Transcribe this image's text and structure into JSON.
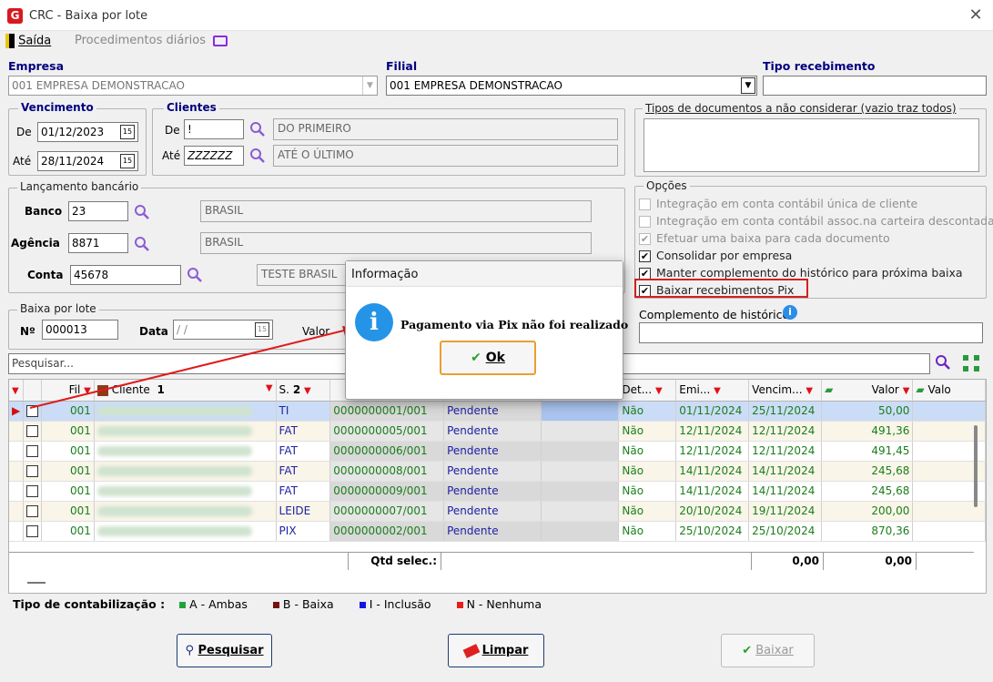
{
  "window": {
    "title": "CRC - Baixa por lote"
  },
  "menu": {
    "exit": "Saída",
    "daily": "Procedimentos diários"
  },
  "empresa": {
    "label": "Empresa",
    "value": "001 EMPRESA DEMONSTRACAO"
  },
  "filial": {
    "label": "Filial",
    "value": "001 EMPRESA DEMONSTRACAO"
  },
  "tipo_recebimento": {
    "label": "Tipo recebimento",
    "value": ""
  },
  "vencimento": {
    "title": "Vencimento",
    "de_label": "De",
    "de": "01/12/2023",
    "ate_label": "Até",
    "ate": "28/11/2024"
  },
  "clientes": {
    "title": "Clientes",
    "de_label": "De",
    "de": "!",
    "de_desc": "DO PRIMEIRO",
    "ate_label": "Até",
    "ate": "ZZZZZZ",
    "ate_desc": "ATÉ O ÚLTIMO"
  },
  "tipos_doc": {
    "title": "Tipos de documentos a não considerar (vazio traz todos)"
  },
  "lancamento": {
    "title": "Lançamento bancário",
    "banco_label": "Banco",
    "banco": "23",
    "banco_desc": "BRASIL",
    "agencia_label": "Agência",
    "agencia": "8871",
    "agencia_desc": "BRASIL",
    "conta_label": "Conta",
    "conta": "45678",
    "conta_desc": "TESTE BRASIL"
  },
  "opcoes": {
    "title": "Opções",
    "items": [
      {
        "label": "Integração em conta contábil única de cliente",
        "checked": false,
        "disabled": true
      },
      {
        "label": "Integração em conta contábil assoc.na carteira descontada",
        "checked": false,
        "disabled": true
      },
      {
        "label": "Efetuar uma baixa para cada documento",
        "checked": true,
        "disabled": true
      },
      {
        "label": "Consolidar por empresa",
        "checked": true,
        "disabled": false
      },
      {
        "label": "Manter complemento do histórico para próxima baixa",
        "checked": true,
        "disabled": false
      },
      {
        "label": "Baixar recebimentos Pix",
        "checked": true,
        "disabled": false
      }
    ]
  },
  "baixa_lote": {
    "title": "Baixa por lote",
    "num_label": "Nº",
    "num": "000013",
    "data_label": "Data",
    "data": " /  /",
    "valor_label": "Valor"
  },
  "complemento": {
    "label": "Complemento de histórico",
    "value": ""
  },
  "search": {
    "placeholder": "Pesquisar..."
  },
  "grid": {
    "headers": {
      "fil": "Fil",
      "cliente": "Cliente",
      "sort1": "1",
      "s": "S.",
      "sort2": "2",
      "det": "Det...",
      "emi": "Emi...",
      "venc": "Vencim...",
      "valor": "Valor",
      "valo": "Valo"
    },
    "rows": [
      {
        "fil": "001",
        "s": "TI",
        "doc": "0000000001/001",
        "status": "Pendente",
        "det": "Não",
        "emi": "01/11/2024",
        "venc": "25/11/2024",
        "valor": "50,00"
      },
      {
        "fil": "001",
        "s": "FAT",
        "doc": "0000000005/001",
        "status": "Pendente",
        "det": "Não",
        "emi": "12/11/2024",
        "venc": "12/11/2024",
        "valor": "491,36"
      },
      {
        "fil": "001",
        "s": "FAT",
        "doc": "0000000006/001",
        "status": "Pendente",
        "det": "Não",
        "emi": "12/11/2024",
        "venc": "12/11/2024",
        "valor": "491,45"
      },
      {
        "fil": "001",
        "s": "FAT",
        "doc": "0000000008/001",
        "status": "Pendente",
        "det": "Não",
        "emi": "14/11/2024",
        "venc": "14/11/2024",
        "valor": "245,68"
      },
      {
        "fil": "001",
        "s": "FAT",
        "doc": "0000000009/001",
        "status": "Pendente",
        "det": "Não",
        "emi": "14/11/2024",
        "venc": "14/11/2024",
        "valor": "245,68"
      },
      {
        "fil": "001",
        "s": "LEIDE",
        "doc": "0000000007/001",
        "status": "Pendente",
        "det": "Não",
        "emi": "20/10/2024",
        "venc": "19/11/2024",
        "valor": "200,00"
      },
      {
        "fil": "001",
        "s": "PIX",
        "doc": "0000000002/001",
        "status": "Pendente",
        "det": "Não",
        "emi": "25/10/2024",
        "venc": "25/10/2024",
        "valor": "870,36"
      }
    ],
    "footer": {
      "qtd_label": "Qtd selec.:",
      "total1": "0,00",
      "total2": "0,00"
    }
  },
  "legend": {
    "label": "Tipo de contabilização :",
    "items": [
      {
        "text": "A - Ambas",
        "color": "#22a33a"
      },
      {
        "text": "B - Baixa",
        "color": "#7a0f0f"
      },
      {
        "text": "I - Inclusão",
        "color": "#1515e0"
      },
      {
        "text": "N - Nenhuma",
        "color": "#e81c1c"
      }
    ]
  },
  "buttons": {
    "pesquisar": "Pesquisar",
    "limpar": "Limpar",
    "baixar": "Baixar"
  },
  "dialog": {
    "title": "Informação",
    "message": "Pagamento via Pix não foi realizado",
    "ok": "Ok"
  },
  "colors": {
    "accent": "#00007f",
    "highlight": "#d32020"
  }
}
